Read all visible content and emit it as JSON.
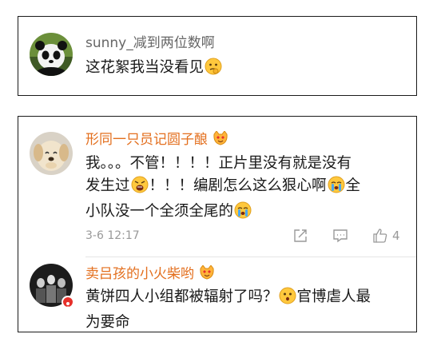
{
  "comments": [
    {
      "username": "sunny_减到两位数啊",
      "content": "这花絮我当没看见"
    },
    {
      "username": "形同一只员记圆子酿",
      "content_line1": "我。。。不管！！！！正片里没有就是没有",
      "content_line2a": "发生过",
      "content_line2b": "！！！编剧怎么这么狠心啊",
      "content_line2c": "全",
      "content_line3": "小队没一个全须全尾的",
      "timestamp": "3-6 12:17",
      "like_count": "4"
    },
    {
      "username": "卖吕孩的小火柴哟",
      "content_line1a": "黄饼四人小组都被辐射了吗？",
      "content_line1b": "官博虐人最",
      "content_line2": "为要命"
    }
  ],
  "colors": {
    "username_orange": "#e36f1e",
    "username_gray": "#666666",
    "meta_gray": "#999999",
    "emoji_yellow": "#ffc83d"
  }
}
